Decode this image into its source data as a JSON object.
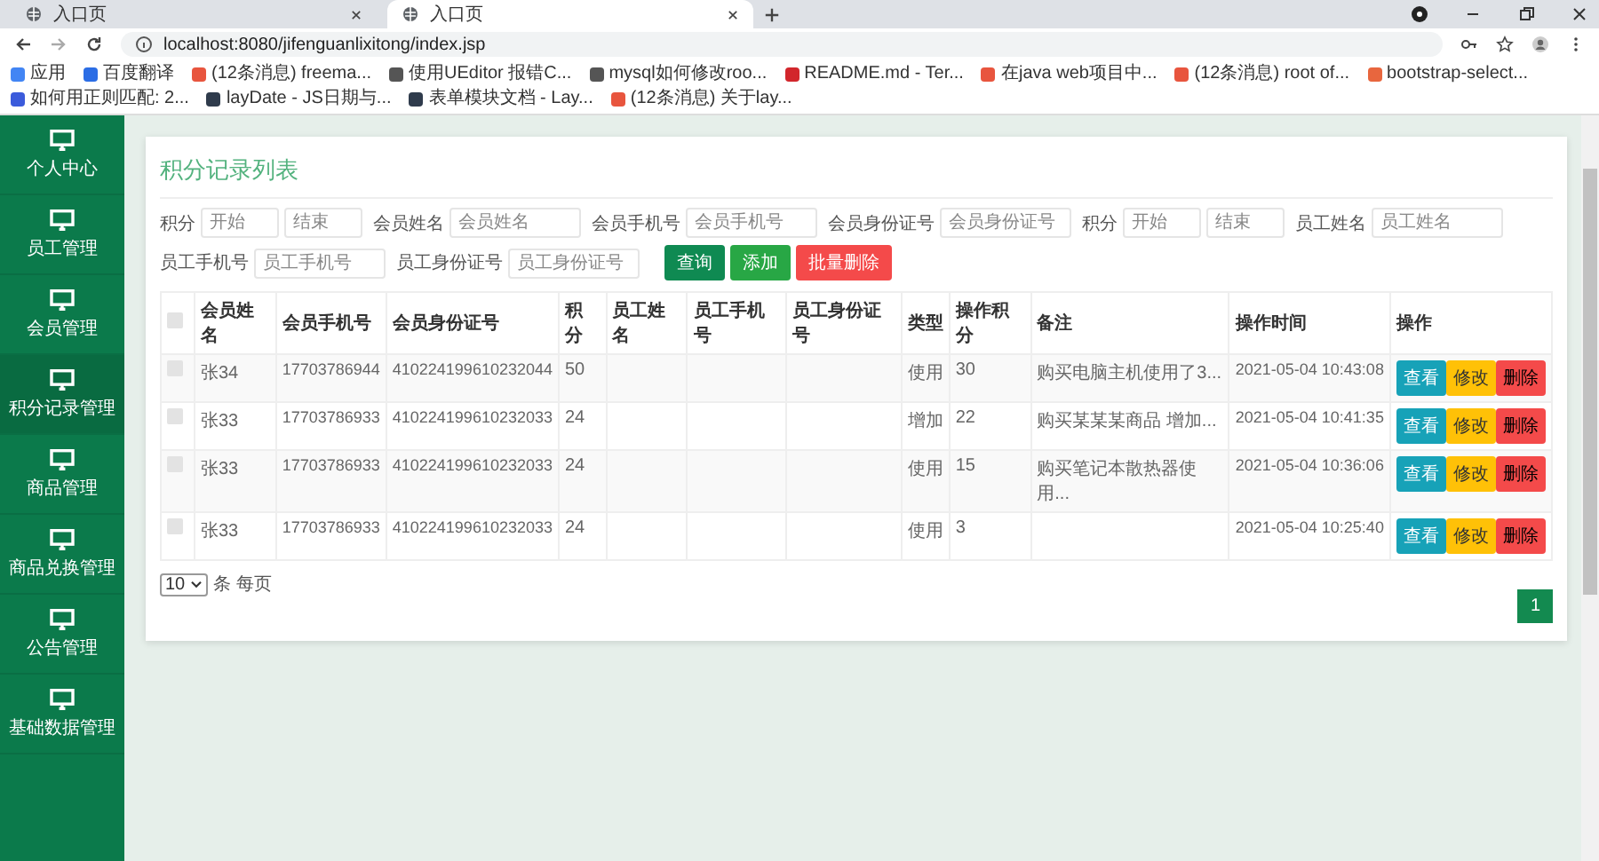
{
  "browser": {
    "tabs": [
      {
        "title": "入口页",
        "selected": false
      },
      {
        "title": "入口页",
        "selected": true
      }
    ],
    "url": "localhost:8080/jifenguanlixitong/index.jsp",
    "bookmarks": [
      {
        "label": "应用",
        "color": "#4285f4"
      },
      {
        "label": "百度翻译",
        "color": "#2b6de5"
      },
      {
        "label": "(12条消息) freema...",
        "color": "#e8553e"
      },
      {
        "label": "使用UEditor 报错C...",
        "color": "#555555"
      },
      {
        "label": "mysql如何修改roo...",
        "color": "#555555"
      },
      {
        "label": "README.md - Ter...",
        "color": "#d2262c"
      },
      {
        "label": "在java web项目中...",
        "color": "#e8553e"
      },
      {
        "label": "(12条消息) root of...",
        "color": "#e8553e"
      },
      {
        "label": "bootstrap-select...",
        "color": "#e8663e"
      },
      {
        "label": "如何用正则匹配: 2...",
        "color": "#3b5bdb"
      },
      {
        "label": "layDate - JS日期与...",
        "color": "#2f3b4c"
      },
      {
        "label": "表单模块文档 - Lay...",
        "color": "#2f3b4c"
      },
      {
        "label": "(12条消息) 关于lay...",
        "color": "#e8553e"
      }
    ]
  },
  "sidebar": {
    "items": [
      {
        "label": "个人中心",
        "selected": false
      },
      {
        "label": "员工管理",
        "selected": false
      },
      {
        "label": "会员管理",
        "selected": false
      },
      {
        "label": "积分记录管理",
        "selected": true
      },
      {
        "label": "商品管理",
        "selected": false
      },
      {
        "label": "商品兑换管理",
        "selected": false
      },
      {
        "label": "公告管理",
        "selected": false
      },
      {
        "label": "基础数据管理",
        "selected": false
      }
    ]
  },
  "panel": {
    "title": "积分记录列表",
    "filters": [
      {
        "kind": "range",
        "label": "积分",
        "start_placeholder": "开始",
        "end_placeholder": "结束"
      },
      {
        "kind": "text",
        "label": "会员姓名",
        "placeholder": "会员姓名"
      },
      {
        "kind": "text",
        "label": "会员手机号",
        "placeholder": "会员手机号"
      },
      {
        "kind": "text",
        "label": "会员身份证号",
        "placeholder": "会员身份证号"
      },
      {
        "kind": "range",
        "label": "积分",
        "start_placeholder": "开始",
        "end_placeholder": "结束"
      },
      {
        "kind": "text",
        "label": "员工姓名",
        "placeholder": "员工姓名"
      },
      {
        "kind": "text",
        "label": "员工手机号",
        "placeholder": "员工手机号"
      },
      {
        "kind": "text",
        "label": "员工身份证号",
        "placeholder": "员工身份证号"
      }
    ],
    "buttons": [
      {
        "label": "查询",
        "kind": "search"
      },
      {
        "label": "添加",
        "kind": "add"
      },
      {
        "label": "批量删除",
        "kind": "delete"
      }
    ],
    "table": {
      "header_checked": false,
      "columns": [
        "会员姓名",
        "会员手机号",
        "会员身份证号",
        "积分",
        "员工姓名",
        "员工手机号",
        "员工身份证号",
        "类型",
        "操作积分",
        "备注",
        "操作时间",
        "操作"
      ],
      "rows": [
        {
          "checked": false,
          "cells": [
            "张34",
            "17703786944",
            "410224199610232044",
            "50",
            null,
            null,
            null,
            "使用",
            "30",
            "购买电脑主机使用了3...",
            "2021-05-04 10:43:08"
          ],
          "actions": [
            {
              "label": "查看",
              "kind": "view"
            },
            {
              "label": "修改",
              "kind": "edit"
            },
            {
              "label": "删除",
              "kind": "delete"
            }
          ]
        },
        {
          "checked": false,
          "cells": [
            "张33",
            "17703786933",
            "410224199610232033",
            "24",
            null,
            null,
            null,
            "增加",
            "22",
            "购买某某某商品 增加...",
            "2021-05-04 10:41:35"
          ],
          "actions": [
            {
              "label": "查看",
              "kind": "view"
            },
            {
              "label": "修改",
              "kind": "edit"
            },
            {
              "label": "删除",
              "kind": "delete"
            }
          ]
        },
        {
          "checked": false,
          "cells": [
            "张33",
            "17703786933",
            "410224199610232033",
            "24",
            null,
            null,
            null,
            "使用",
            "15",
            "购买笔记本散热器使用...",
            "2021-05-04 10:36:06"
          ],
          "actions": [
            {
              "label": "查看",
              "kind": "view"
            },
            {
              "label": "修改",
              "kind": "edit"
            },
            {
              "label": "删除",
              "kind": "delete"
            }
          ]
        },
        {
          "checked": false,
          "cells": [
            "张33",
            "17703786933",
            "410224199610232033",
            "24",
            null,
            null,
            null,
            "使用",
            "3",
            null,
            "2021-05-04 10:25:40"
          ],
          "actions": [
            {
              "label": "查看",
              "kind": "view"
            },
            {
              "label": "修改",
              "kind": "edit"
            },
            {
              "label": "删除",
              "kind": "delete"
            }
          ]
        }
      ]
    },
    "page_size": "10",
    "page_size_label": "条 每页",
    "pages": [
      {
        "label": "1",
        "selected": true
      }
    ]
  }
}
